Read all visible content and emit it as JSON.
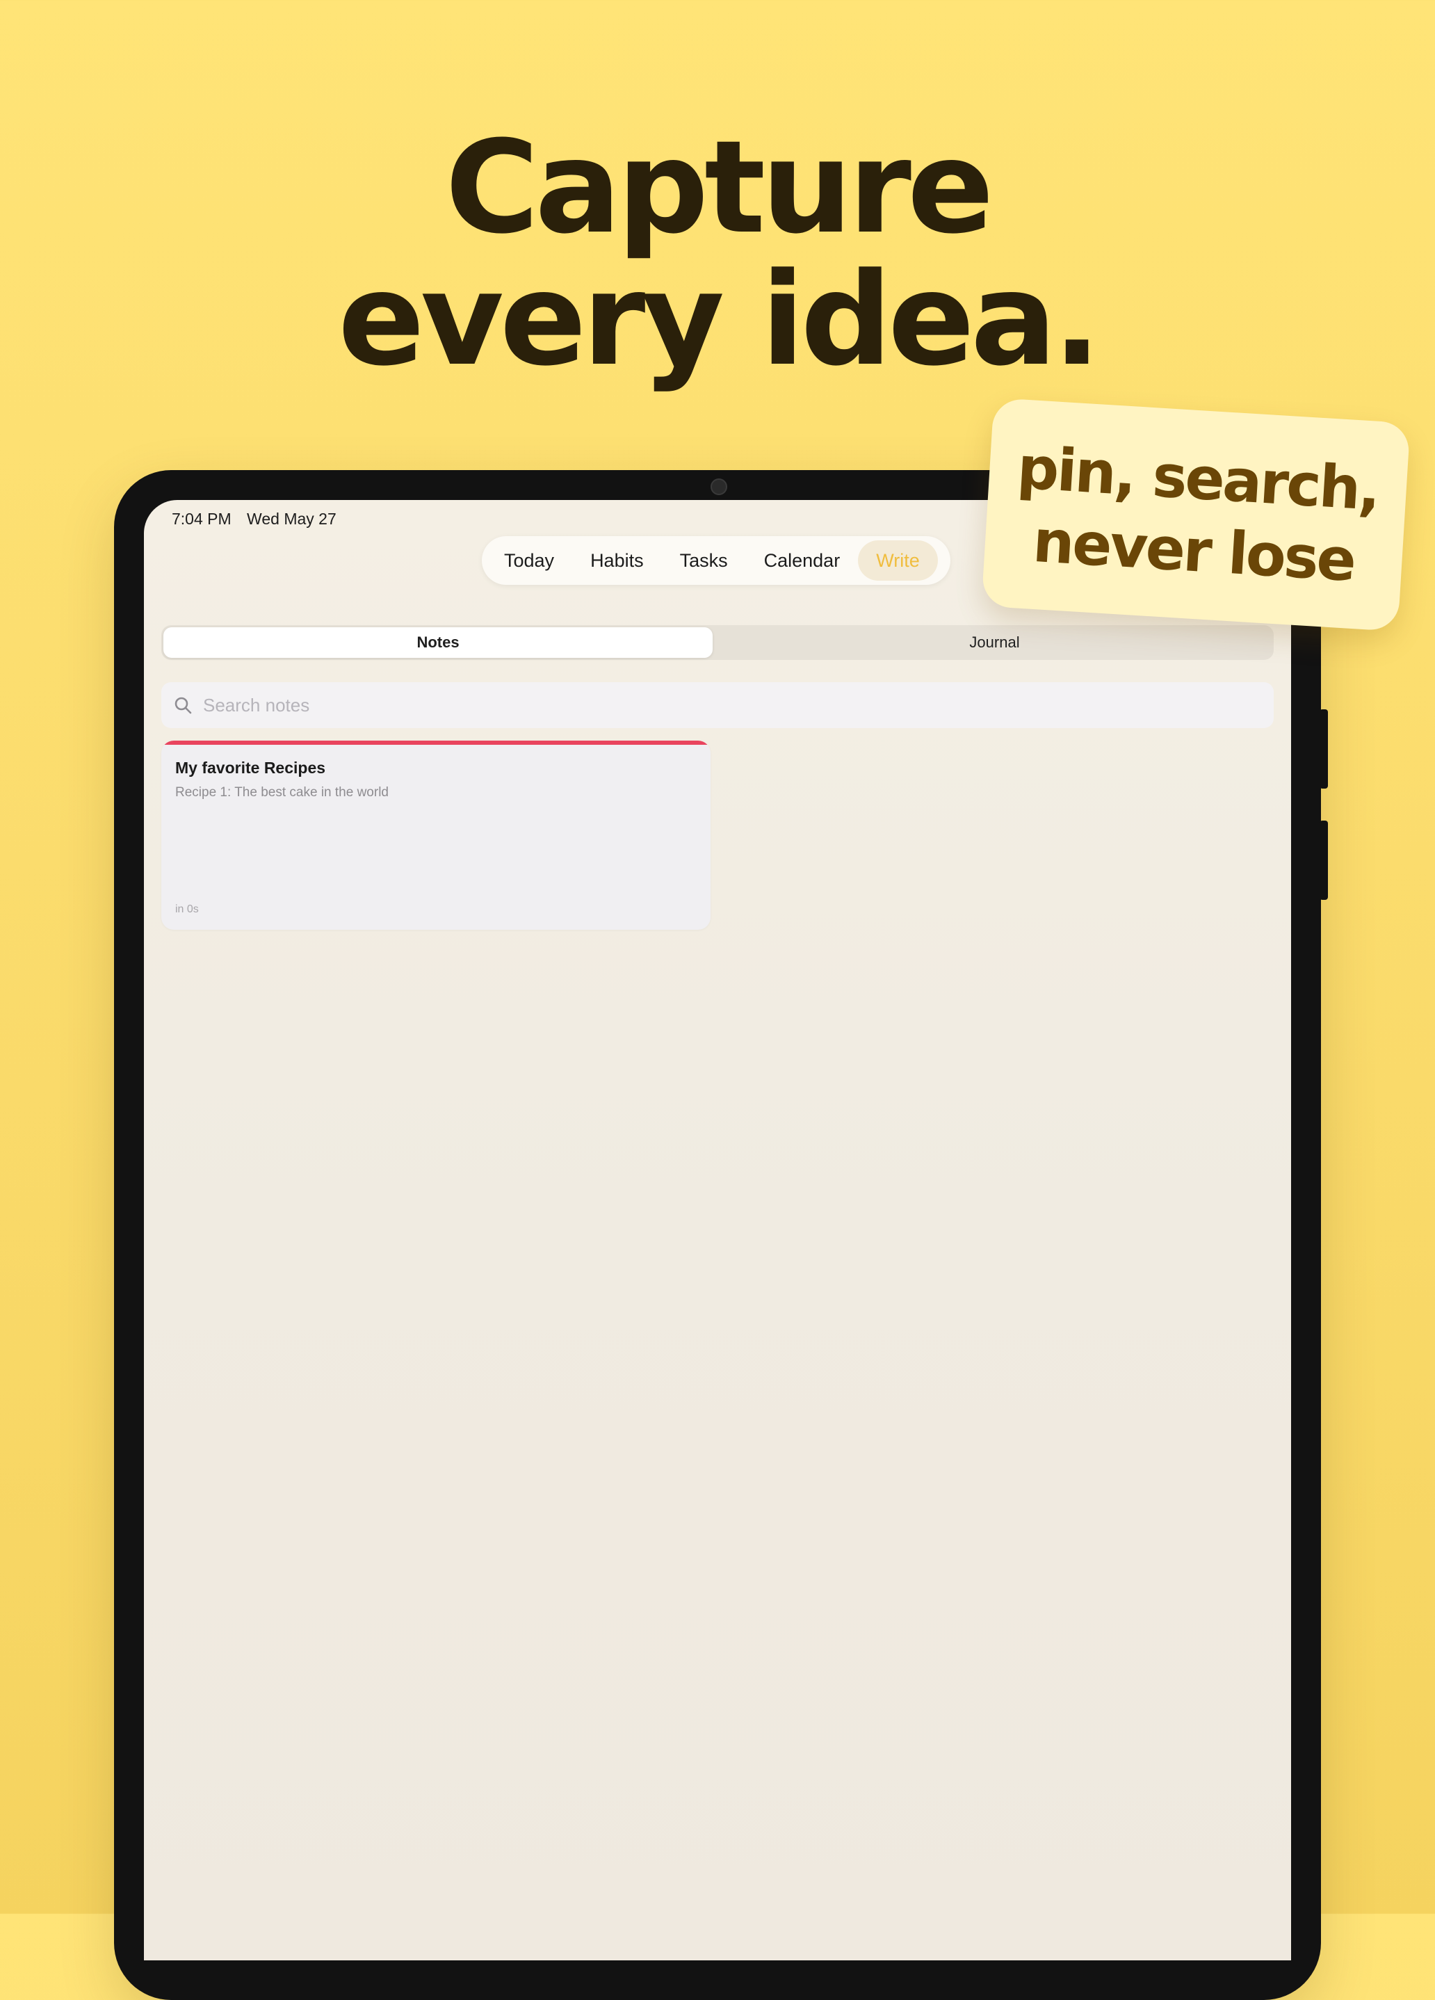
{
  "headline": {
    "line1": "Capture",
    "line2": "every idea."
  },
  "sticker": {
    "line1": "pin, search,",
    "line2": "never lose"
  },
  "status_bar": {
    "time": "7:04 PM",
    "date": "Wed May 27"
  },
  "nav": {
    "tabs": [
      {
        "label": "Today"
      },
      {
        "label": "Habits"
      },
      {
        "label": "Tasks"
      },
      {
        "label": "Calendar"
      },
      {
        "label": "Write"
      }
    ],
    "active": "Write"
  },
  "segment": {
    "notes_label": "Notes",
    "journal_label": "Journal",
    "selected": "Notes"
  },
  "search": {
    "placeholder": "Search notes",
    "value": "",
    "icon": "search-icon"
  },
  "notes": [
    {
      "title": "My favorite Recipes",
      "preview": "Recipe 1: The best cake in the world",
      "time": "in 0s",
      "accent_color": "#e9445e"
    }
  ],
  "colors": {
    "background": "#fbdc6d",
    "headline": "#2a200a",
    "accent": "#f0bd3e",
    "sticker_bg": "#fff4c2",
    "sticker_text": "#6a4607"
  }
}
